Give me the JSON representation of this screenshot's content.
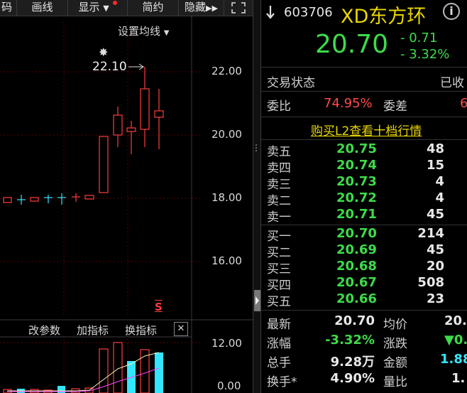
{
  "toolbar": {
    "items": [
      "码",
      "画线",
      "显示",
      "简约",
      "隐藏"
    ],
    "expand_icon": "fullscreen-icon",
    "forward_icon": "double-chevron-right-icon"
  },
  "chart": {
    "setting_label": "设置均线",
    "high_marker": "22.10",
    "price_ticks": [
      "22.00",
      "20.00",
      "18.00",
      "16.00"
    ],
    "sub_ticks": [
      "12.00",
      "0.00"
    ],
    "sub_buttons": [
      "改参数",
      "加指标",
      "换指标"
    ],
    "close_glyph": "✕",
    "s_marker": "S"
  },
  "stock": {
    "code": "603706",
    "name": "XD东方环",
    "price": "20.70",
    "change": "- 0.71",
    "change_pct": "- 3.32%",
    "trade_status_label": "交易状态",
    "trade_status_value": "已收",
    "weibi_label": "委比",
    "weibi_value": "74.95%",
    "weicha_label": "委差",
    "weicha_value": "6",
    "l2_link": "购买L2查看十档行情"
  },
  "sell": [
    {
      "label": "卖五",
      "price": "20.75",
      "vol": "48"
    },
    {
      "label": "卖四",
      "price": "20.74",
      "vol": "15"
    },
    {
      "label": "卖三",
      "price": "20.73",
      "vol": "4"
    },
    {
      "label": "卖二",
      "price": "20.72",
      "vol": "4"
    },
    {
      "label": "卖一",
      "price": "20.71",
      "vol": "45"
    }
  ],
  "buy": [
    {
      "label": "买一",
      "price": "20.70",
      "vol": "214"
    },
    {
      "label": "买二",
      "price": "20.69",
      "vol": "45"
    },
    {
      "label": "买三",
      "price": "20.68",
      "vol": "20"
    },
    {
      "label": "买四",
      "price": "20.67",
      "vol": "508"
    },
    {
      "label": "买五",
      "price": "20.66",
      "vol": "23"
    }
  ],
  "stats": [
    {
      "l1": "最新",
      "v1": "20.70",
      "c1": "white",
      "l2": "均价",
      "v2": "20.",
      "c2": "white"
    },
    {
      "l1": "涨幅",
      "v1": "-3.32%",
      "c1": "green",
      "l2": "涨跌",
      "v2": "▼0.",
      "c2": "green"
    },
    {
      "l1": "总手",
      "v1": "9.28万",
      "c1": "white",
      "l2": "金额",
      "v2": "1.88",
      "c2": "cyan"
    },
    {
      "l1": "换手*",
      "v1": "4.90%",
      "c1": "white",
      "l2": "量比",
      "v2": "1.",
      "c2": "white"
    }
  ],
  "colors": {
    "up": "#ff3c3c",
    "down": "#3ddc4a",
    "accent": "#33e6ff",
    "brand": "#e8d600"
  }
}
